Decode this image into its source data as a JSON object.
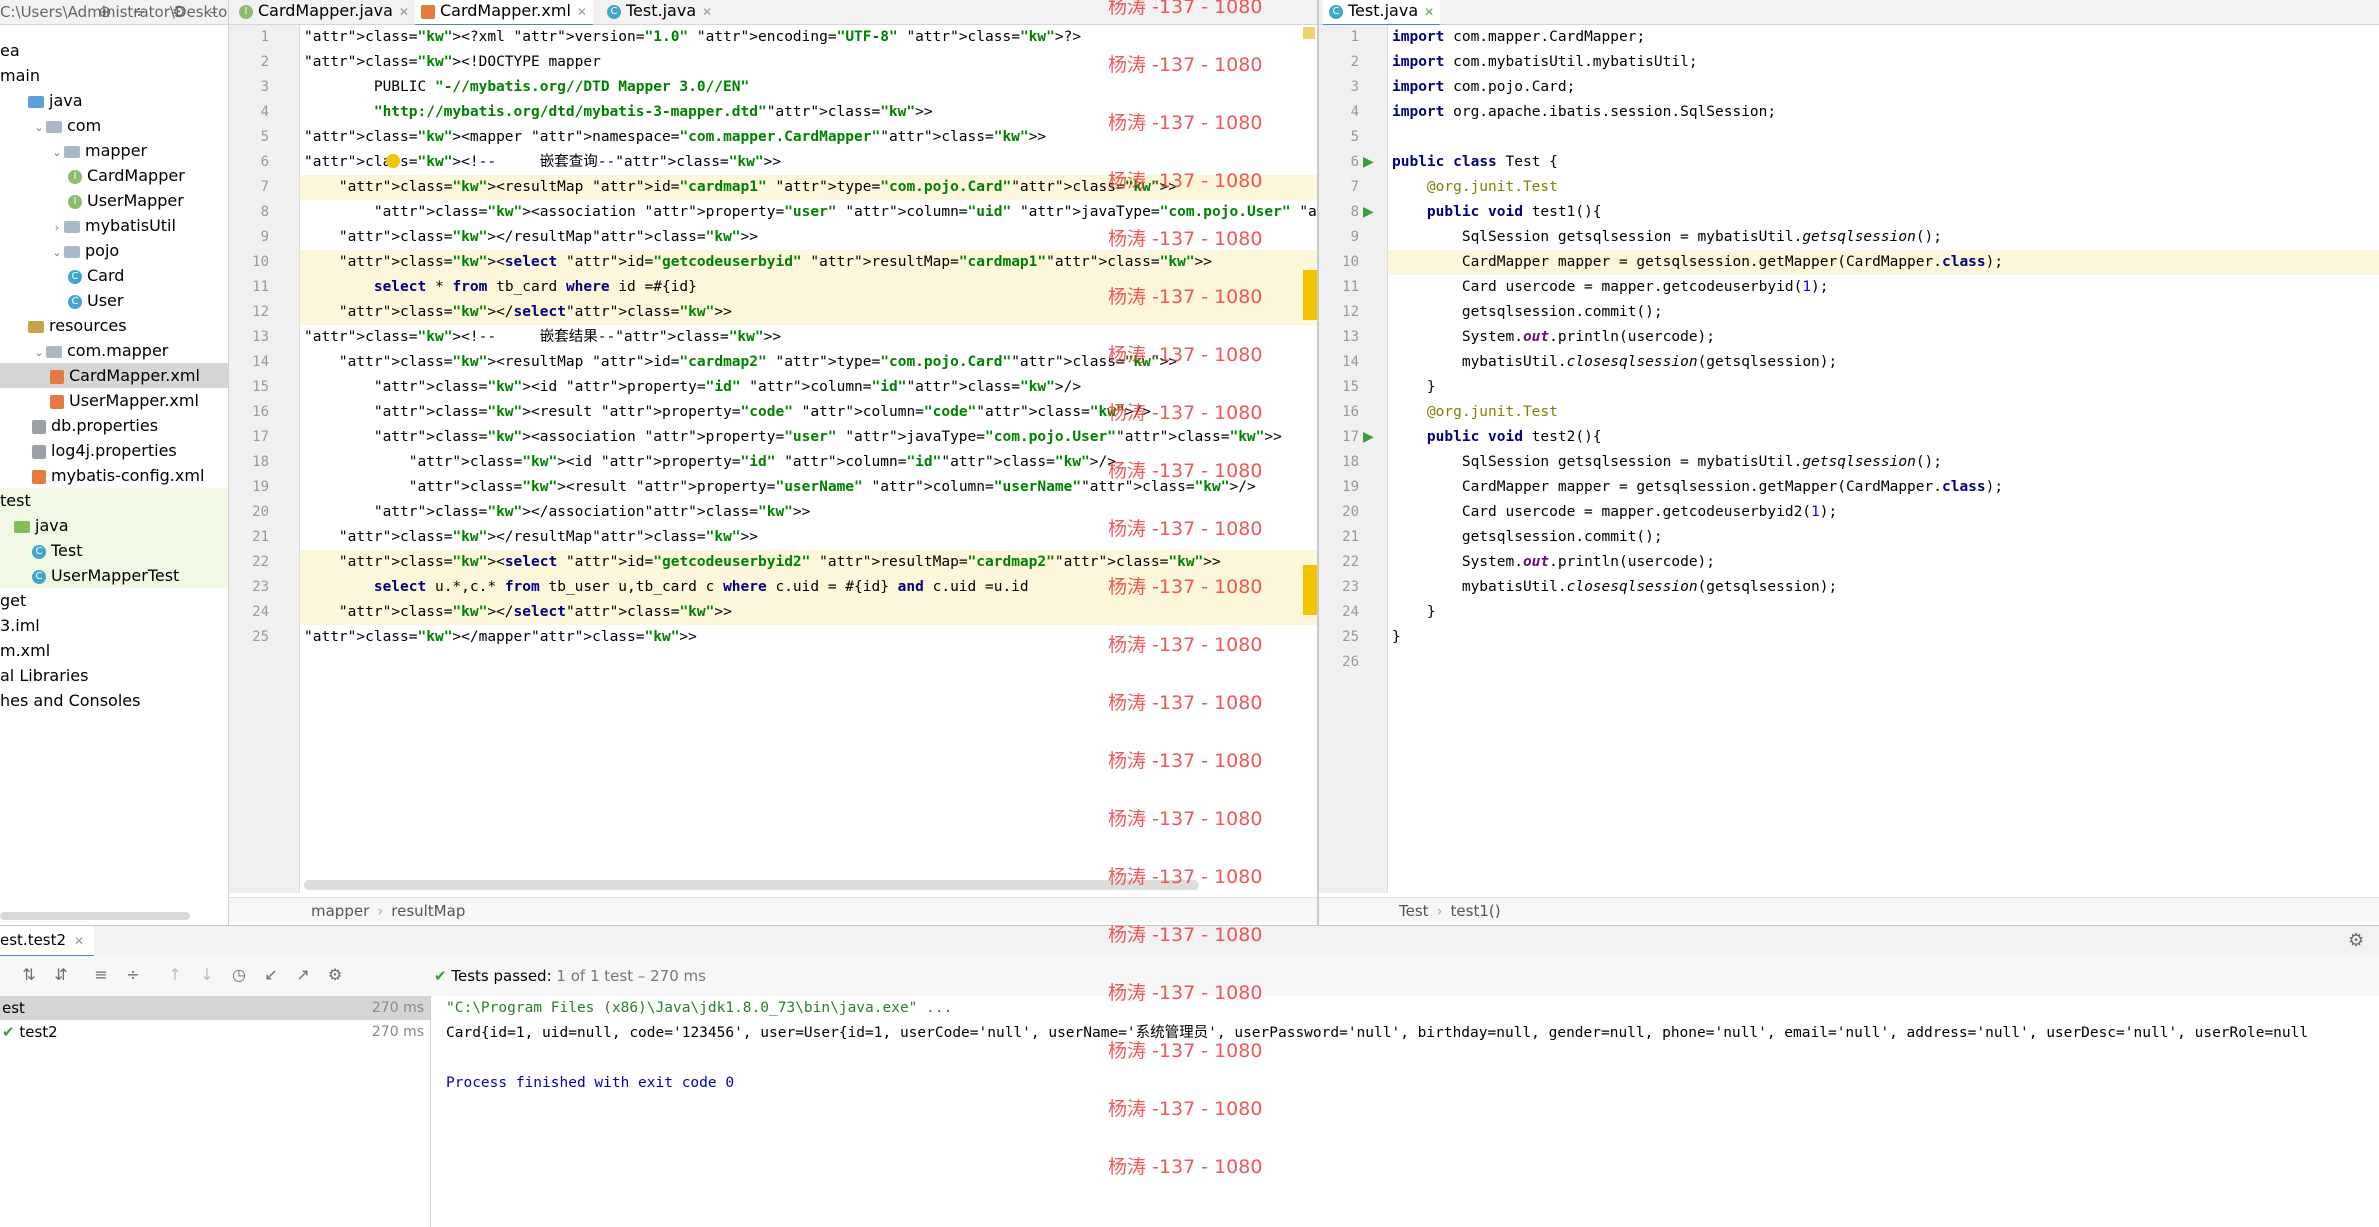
{
  "project": {
    "path": "C:\\Users\\Administrator\\Desktop\\",
    "items": [
      {
        "label": "ea",
        "icon": "none"
      },
      {
        "label": "main",
        "icon": "none"
      },
      {
        "label": "java",
        "icon": "folder-src"
      },
      {
        "label": "com",
        "icon": "folder"
      },
      {
        "label": "mapper",
        "icon": "folder"
      },
      {
        "label": "CardMapper",
        "icon": "interface"
      },
      {
        "label": "UserMapper",
        "icon": "interface"
      },
      {
        "label": "mybatisUtil",
        "icon": "folder"
      },
      {
        "label": "pojo",
        "icon": "folder"
      },
      {
        "label": "Card",
        "icon": "class"
      },
      {
        "label": "User",
        "icon": "class"
      },
      {
        "label": "resources",
        "icon": "folder-res"
      },
      {
        "label": "com.mapper",
        "icon": "folder"
      },
      {
        "label": "CardMapper.xml",
        "icon": "xml"
      },
      {
        "label": "UserMapper.xml",
        "icon": "xml"
      },
      {
        "label": "db.properties",
        "icon": "properties"
      },
      {
        "label": "log4j.properties",
        "icon": "properties"
      },
      {
        "label": "mybatis-config.xml",
        "icon": "xml"
      },
      {
        "label": "test",
        "icon": "none"
      },
      {
        "label": "java",
        "icon": "folder-test"
      },
      {
        "label": "Test",
        "icon": "class"
      },
      {
        "label": "UserMapperTest",
        "icon": "class"
      },
      {
        "label": "get",
        "icon": "none"
      },
      {
        "label": "3.iml",
        "icon": "none"
      },
      {
        "label": "m.xml",
        "icon": "none"
      },
      {
        "label": "al Libraries",
        "icon": "none"
      },
      {
        "label": "hes and Consoles",
        "icon": "none"
      }
    ]
  },
  "left_tabs": [
    {
      "label": "CardMapper.java",
      "icon": "interface"
    },
    {
      "label": "CardMapper.xml",
      "icon": "xml"
    },
    {
      "label": "Test.java",
      "icon": "class"
    }
  ],
  "right_tabs": [
    {
      "label": "Test.java",
      "icon": "class"
    }
  ],
  "xml_lines": [
    "<?xml version=\"1.0\" encoding=\"UTF-8\" ?>",
    "<!DOCTYPE mapper",
    "        PUBLIC \"-//mybatis.org//DTD Mapper 3.0//EN\"",
    "        \"http://mybatis.org/dtd/mybatis-3-mapper.dtd\">",
    "<mapper namespace=\"com.mapper.CardMapper\">",
    "<!--     嵌套查询-->",
    "    <resultMap id=\"cardmap1\" type=\"com.pojo.Card\">",
    "        <association property=\"user\" column=\"uid\" javaType=\"com.pojo.User\" select=\"com.mapper.UserMapper.getuser",
    "    </resultMap>",
    "    <select id=\"getcodeuserbyid\" resultMap=\"cardmap1\">",
    "        select * from tb_card where id =#{id}",
    "    </select>",
    "<!--     嵌套结果-->",
    "    <resultMap id=\"cardmap2\" type=\"com.pojo.Card\">",
    "        <id property=\"id\" column=\"id\"/>",
    "        <result property=\"code\" column=\"code\"/>",
    "        <association property=\"user\" javaType=\"com.pojo.User\">",
    "            <id property=\"id\" column=\"id\"/>",
    "            <result property=\"userName\" column=\"userName\"/>",
    "        </association>",
    "    </resultMap>",
    "    <select id=\"getcodeuserbyid2\" resultMap=\"cardmap2\">",
    "        select u.*,c.* from tb_user u,tb_card c where c.uid = #{id} and c.uid =u.id",
    "    </select>",
    "</mapper>"
  ],
  "java_lines": [
    "import com.mapper.CardMapper;",
    "import com.mybatisUtil.mybatisUtil;",
    "import com.pojo.Card;",
    "import org.apache.ibatis.session.SqlSession;",
    "",
    "public class Test {",
    "    @org.junit.Test",
    "    public void test1(){",
    "        SqlSession getsqlsession = mybatisUtil.getsqlsession();",
    "        CardMapper mapper = getsqlsession.getMapper(CardMapper.class);",
    "        Card usercode = mapper.getcodeuserbyid(1);",
    "        getsqlsession.commit();",
    "        System.out.println(usercode);",
    "        mybatisUtil.closesqlsession(getsqlsession);",
    "    }",
    "    @org.junit.Test",
    "    public void test2(){",
    "        SqlSession getsqlsession = mybatisUtil.getsqlsession();",
    "        CardMapper mapper = getsqlsession.getMapper(CardMapper.class);",
    "        Card usercode = mapper.getcodeuserbyid2(1);",
    "        getsqlsession.commit();",
    "        System.out.println(usercode);",
    "        mybatisUtil.closesqlsession(getsqlsession);",
    "    }",
    "}",
    ""
  ],
  "left_breadcrumb": [
    "mapper",
    "resultMap"
  ],
  "right_breadcrumb": [
    "Test",
    "test1()"
  ],
  "watermark": "杨涛 -137 - 1080",
  "run": {
    "tab_label": "est.test2",
    "status_bold": "Tests passed:",
    "status_rest": "1 of 1 test – 270 ms",
    "tree": [
      {
        "label": "est",
        "time": "270 ms"
      },
      {
        "label": "test2",
        "time": "270 ms"
      }
    ],
    "console": [
      "\"C:\\Program Files (x86)\\Java\\jdk1.8.0_73\\bin\\java.exe\" ...",
      "Card{id=1, uid=null, code='123456', user=User{id=1, userCode='null', userName='系统管理员', userPassword='null', birthday=null, gender=null, phone='null', email='null', address='null', userDesc='null', userRole=null",
      "",
      "Process finished with exit code 0"
    ]
  }
}
